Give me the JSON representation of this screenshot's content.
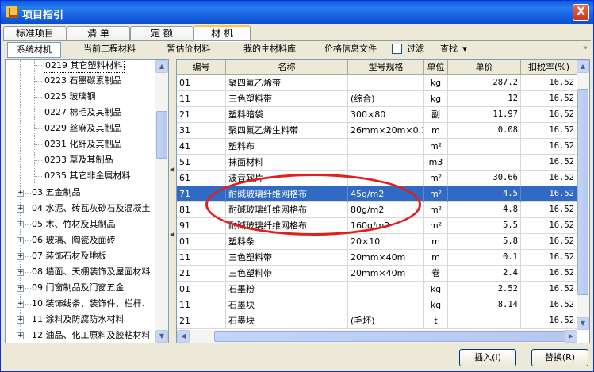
{
  "window": {
    "title": "项目指引",
    "close_label": "X"
  },
  "tabs": [
    "标准项目",
    "清 单",
    "定 额",
    "材 机"
  ],
  "toolbar": {
    "items": [
      "系统材机",
      "当前工程材料",
      "暂估价材料",
      "我的主材料库",
      "价格信息文件"
    ],
    "filter_label": "过滤",
    "find_label": "查找",
    "dropdown_glyph": "▾",
    "overflow_glyph": "»"
  },
  "tree": {
    "children": [
      "0219 其它塑料材料",
      "0223 石墨碳素制品",
      "0225 玻璃钢",
      "0227 棉毛及其制品",
      "0229 丝麻及其制品",
      "0231 化纤及其制品",
      "0233 草及其制品",
      "0235 其它非金属材料"
    ],
    "groups": [
      "03 五金制品",
      "04 水泥、砖瓦灰砂石及混凝土",
      "05 木、竹材及其制品",
      "06 玻璃、陶瓷及面砖",
      "07 装饰石材及地板",
      "08 墙面、天棚装饰及屋面材料",
      "09 门窗制品及门窗五金",
      "10 装饰线条、装饰件、栏杆、",
      "11 涂料及防腐防水材料",
      "12 油品、化工原料及胶粘材料"
    ],
    "expand_glyph": "+"
  },
  "grid": {
    "columns": [
      "编号",
      "名称",
      "型号规格",
      "单位",
      "单价",
      "扣税率(%)"
    ],
    "rows": [
      {
        "code": "01",
        "name": "聚四氟乙烯带",
        "spec": "",
        "unit": "kg",
        "price": "287.2",
        "tax": "16.52"
      },
      {
        "code": "11",
        "name": "三色塑料带",
        "spec": "(综合)",
        "unit": "kg",
        "price": "12",
        "tax": "16.52"
      },
      {
        "code": "21",
        "name": "塑料暗袋",
        "spec": "300×80",
        "unit": "副",
        "price": "11.97",
        "tax": "16.52"
      },
      {
        "code": "31",
        "name": "聚四氟乙烯生料带",
        "spec": "26mm×20m×0.1",
        "unit": "m",
        "price": "0.08",
        "tax": "16.52"
      },
      {
        "code": "41",
        "name": "塑料布",
        "spec": "",
        "unit": "m²",
        "price": "",
        "tax": "16.52"
      },
      {
        "code": "51",
        "name": "抹面材料",
        "spec": "",
        "unit": "m3",
        "price": "",
        "tax": "16.52"
      },
      {
        "code": "61",
        "name": "波音软片",
        "spec": "",
        "unit": "m²",
        "price": "30.66",
        "tax": "16.52"
      },
      {
        "code": "71",
        "name": "耐碱玻璃纤维网格布",
        "spec": "45g/m2",
        "unit": "m²",
        "price": "4.5",
        "tax": "16.52"
      },
      {
        "code": "81",
        "name": "耐碱玻璃纤维网格布",
        "spec": "80g/m2",
        "unit": "m²",
        "price": "4.8",
        "tax": "16.52"
      },
      {
        "code": "91",
        "name": "耐碱玻璃纤维网格布",
        "spec": "160g/m2",
        "unit": "m²",
        "price": "5.5",
        "tax": "16.52"
      },
      {
        "code": "01",
        "name": "塑料条",
        "spec": "20×10",
        "unit": "m",
        "price": "5.8",
        "tax": "16.52"
      },
      {
        "code": "11",
        "name": "三色塑料带",
        "spec": "20mm×40m",
        "unit": "m",
        "price": "0.1",
        "tax": "16.52"
      },
      {
        "code": "21",
        "name": "三色塑料带",
        "spec": "20mm×40m",
        "unit": "卷",
        "price": "2.4",
        "tax": "16.52"
      },
      {
        "code": "01",
        "name": "石墨粉",
        "spec": "",
        "unit": "kg",
        "price": "2.52",
        "tax": "16.52"
      },
      {
        "code": "11",
        "name": "石墨块",
        "spec": "",
        "unit": "kg",
        "price": "8.14",
        "tax": "16.52"
      },
      {
        "code": "21",
        "name": "石墨块",
        "spec": "(毛坯)",
        "unit": "t",
        "price": "",
        "tax": "16.52"
      }
    ],
    "selected_row": 7
  },
  "buttons": {
    "insert": "插入(I)",
    "replace": "替换(R)"
  },
  "colors": {
    "selection": "#316ac5",
    "annotation": "#e0201a",
    "titlebar": "#0a5bdc"
  }
}
